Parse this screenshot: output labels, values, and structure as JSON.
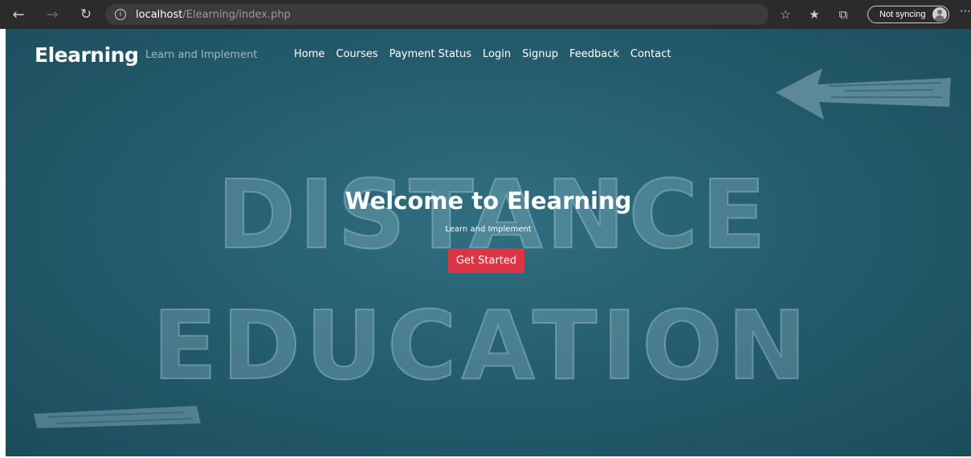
{
  "browser": {
    "url_host": "localhost",
    "url_path": "/Elearning/index.php",
    "sync_label": "Not syncing"
  },
  "navbar": {
    "brand": "Elearning",
    "tagline": "Learn and Implement",
    "links": [
      "Home",
      "Courses",
      "Payment Status",
      "Login",
      "Signup",
      "Feedback",
      "Contact"
    ]
  },
  "background": {
    "line1": "DISTANCE",
    "line2": "EDUCATION"
  },
  "hero": {
    "title": "Welcome to Elearning",
    "subtitle": "Learn and Implement",
    "cta_label": "Get Started"
  },
  "colors": {
    "page_bg": "#235a6b",
    "cta": "#dc3545",
    "chrome_bg": "#2b2b2b"
  }
}
